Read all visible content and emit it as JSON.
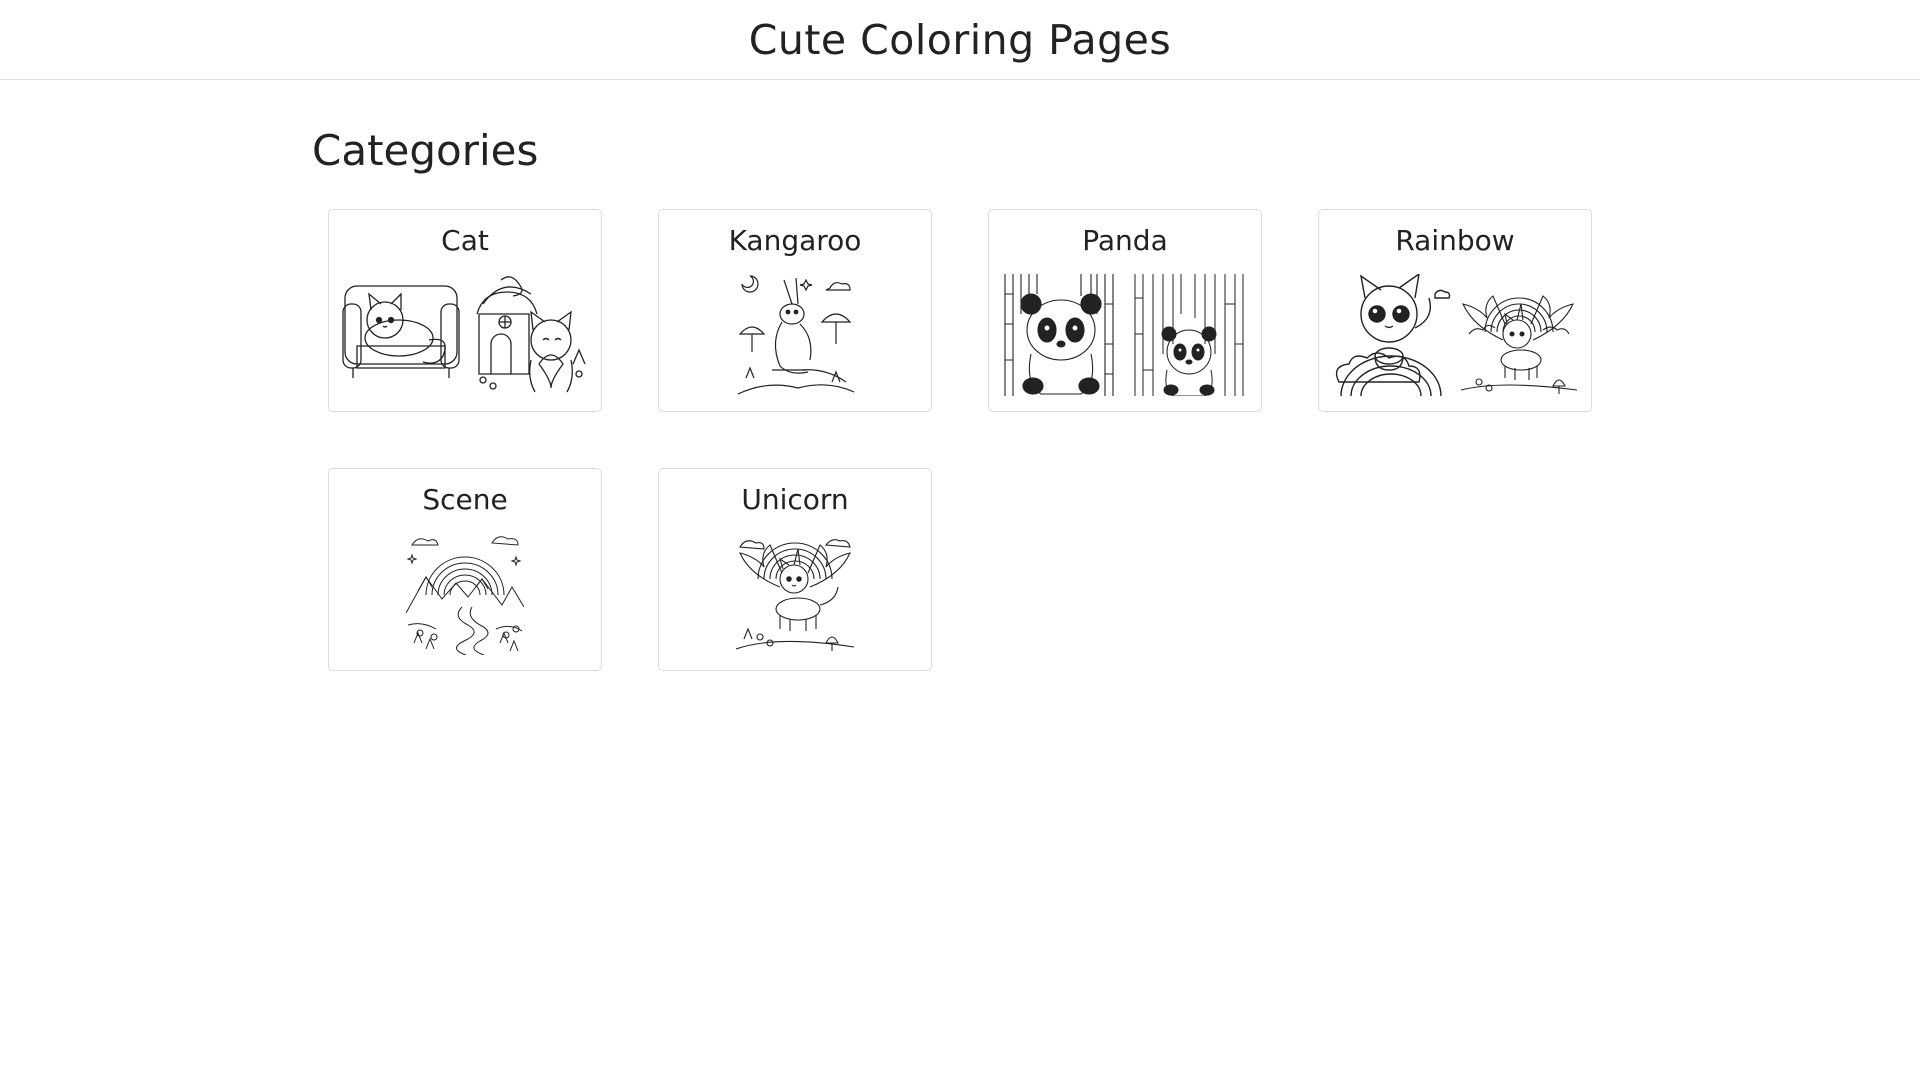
{
  "header": {
    "title": "Cute Coloring Pages"
  },
  "main": {
    "section_title": "Categories",
    "categories": [
      {
        "label": "Cat",
        "thumbnails": [
          "cat-on-sofa-illustration",
          "cat-holding-heart-illustration"
        ]
      },
      {
        "label": "Kangaroo",
        "thumbnails": [
          "kangaroo-mushrooms-illustration"
        ]
      },
      {
        "label": "Panda",
        "thumbnails": [
          "panda-bamboo-illustration",
          "panda-bamboo-forest-illustration"
        ]
      },
      {
        "label": "Rainbow",
        "thumbnails": [
          "kitten-on-rainbow-illustration",
          "winged-unicorn-cat-rainbow-illustration"
        ]
      },
      {
        "label": "Scene",
        "thumbnails": [
          "rainbow-mountain-landscape-illustration"
        ]
      },
      {
        "label": "Unicorn",
        "thumbnails": [
          "winged-unicorn-cat-illustration"
        ]
      }
    ]
  }
}
